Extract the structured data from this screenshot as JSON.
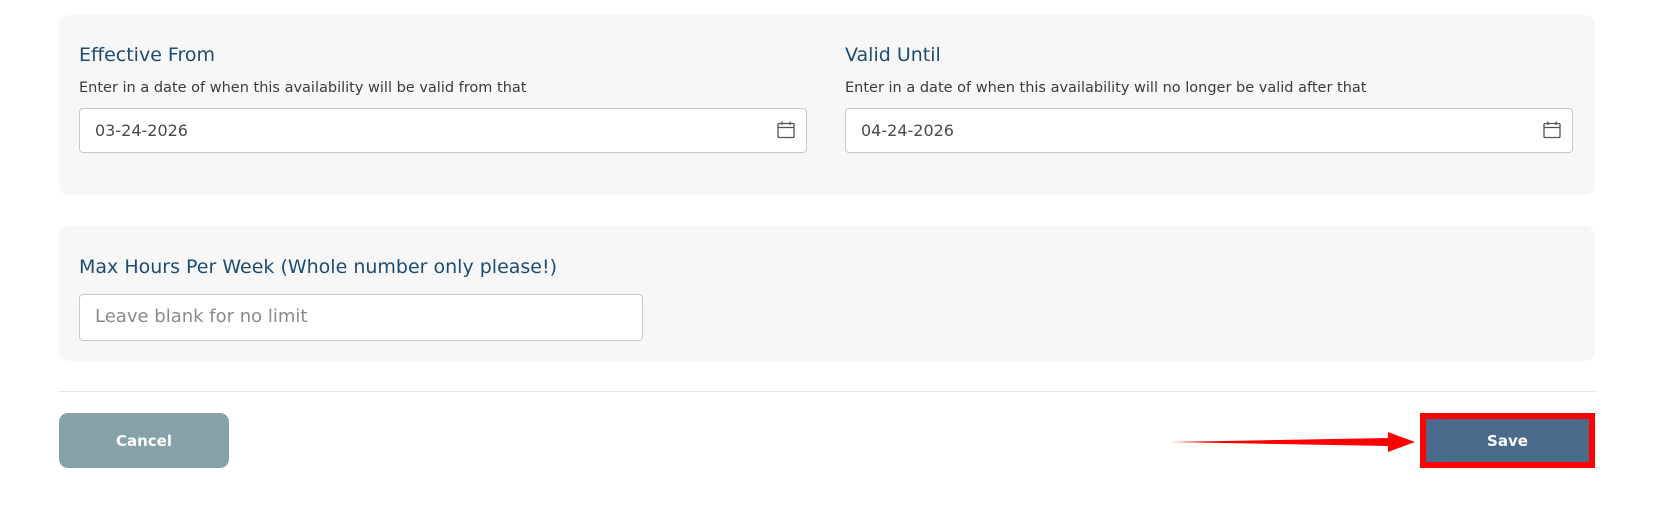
{
  "effective_from": {
    "title": "Effective From",
    "help": "Enter in a date of when this availability will be valid from that",
    "value": "03-24-2026",
    "icon": "calendar-icon"
  },
  "valid_until": {
    "title": "Valid Until",
    "help": "Enter in a date of when this availability will no longer be valid after that",
    "value": "04-24-2026",
    "icon": "calendar-icon"
  },
  "max_hours": {
    "title": "Max Hours Per Week (Whole number only please!)",
    "placeholder": "Leave blank for no limit",
    "value": ""
  },
  "actions": {
    "cancel_label": "Cancel",
    "save_label": "Save"
  },
  "colors": {
    "title": "#1d4c73",
    "panel_bg": "#f7f7f7",
    "cancel_bg": "#86a1a7",
    "save_bg": "#4a6a8c",
    "highlight": "#ff0000"
  }
}
